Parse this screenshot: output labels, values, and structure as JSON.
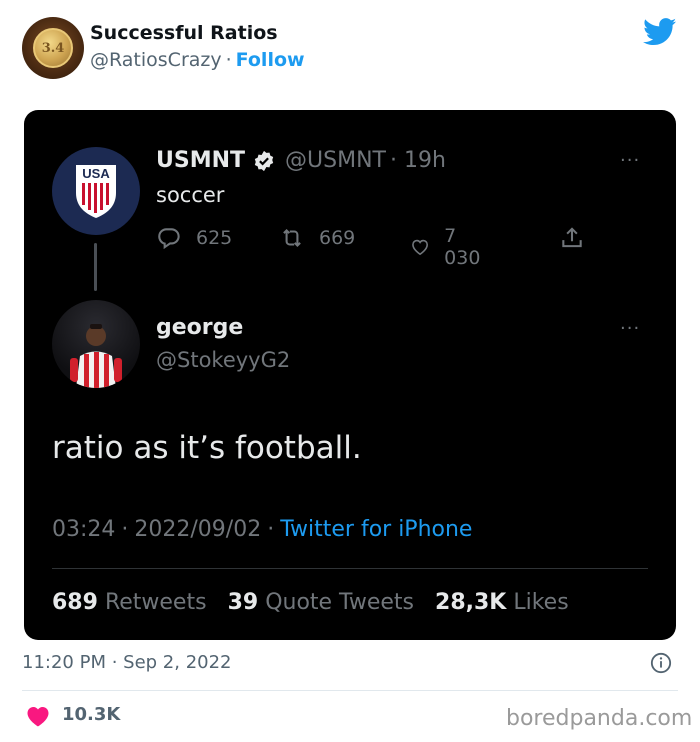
{
  "account": {
    "name": "Successful Ratios",
    "handle": "@RatiosCrazy",
    "separator": "·",
    "follow_label": "Follow",
    "avatar_text": "3.4",
    "brand_icon": "twitter-bird-icon"
  },
  "screenshot": {
    "original_tweet": {
      "name": "USMNT",
      "handle": "@USMNT",
      "age": "· 19h",
      "text": "soccer",
      "replies": "625",
      "retweets": "669",
      "likes": "7 030",
      "avatar_text": "USA",
      "more": "···"
    },
    "reply_tweet": {
      "name": "george",
      "handle": "@StokeyyG2",
      "text": "ratio as it’s football.",
      "time": "03:24",
      "date": "2022/09/02",
      "separator": "·",
      "source": "Twitter for iPhone",
      "more": "···",
      "retweets_count": "689",
      "retweets_label": "Retweets",
      "quote_count": "39",
      "quote_label": "Quote Tweets",
      "likes_count": "28,3K",
      "likes_label": "Likes"
    }
  },
  "footer": {
    "timestamp": "11:20 PM · Sep 2, 2022",
    "like_count": "10.3K",
    "watermark": "boredpanda.com"
  },
  "colors": {
    "link_blue": "#1d9bf0",
    "like_red": "#f91880",
    "dark_bg": "#000000"
  }
}
